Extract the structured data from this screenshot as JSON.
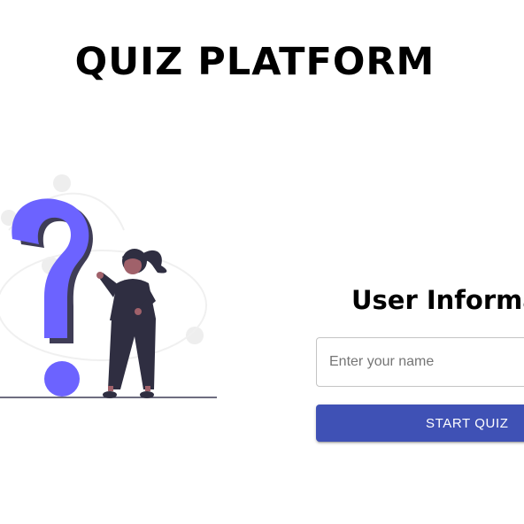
{
  "header": {
    "title": "QUIZ PLATFORM"
  },
  "illustration": {
    "icon": "question-mark-person-illustration",
    "accent": "#6c63ff"
  },
  "form": {
    "heading": "User Information",
    "name_input": {
      "value": "",
      "placeholder": "Enter your name"
    },
    "start_button_label": "START QUIZ"
  },
  "colors": {
    "primary": "#3f51b5",
    "accent": "#6c63ff",
    "text": "#000000"
  }
}
